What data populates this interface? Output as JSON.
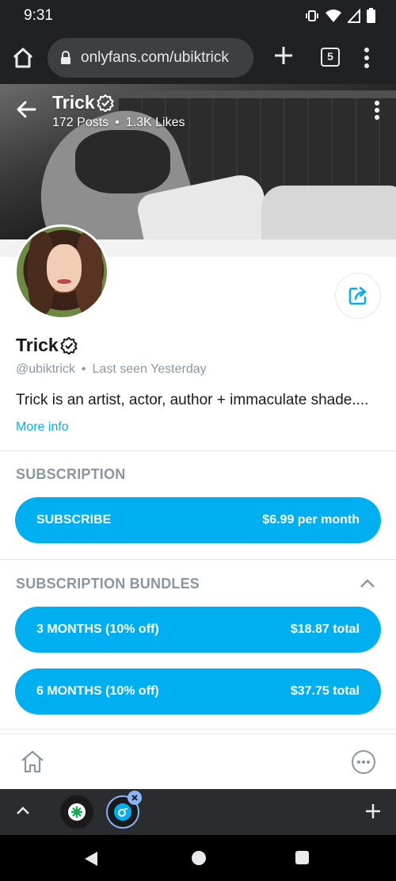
{
  "status_bar": {
    "time": "9:31"
  },
  "browser": {
    "url": "onlyfans.com/ubiktrick",
    "tab_count": "5"
  },
  "profile_header": {
    "name": "Trick",
    "posts": "172 Posts",
    "likes": "1.3K Likes",
    "separator": "•"
  },
  "profile": {
    "name": "Trick",
    "handle": "@ubiktrick",
    "last_seen": "Last seen Yesterday",
    "separator": "•",
    "bio": "Trick is an artist, actor, author + immaculate shade....",
    "more_info": "More info"
  },
  "subscription": {
    "title": "SUBSCRIPTION",
    "subscribe_label": "SUBSCRIBE",
    "price": "$6.99 per month"
  },
  "bundles": {
    "title": "SUBSCRIPTION BUNDLES",
    "items": [
      {
        "label": "3 MONTHS (10% off)",
        "price": "$18.87 total"
      },
      {
        "label": "6 MONTHS (10% off)",
        "price": "$37.75 total"
      }
    ]
  },
  "colors": {
    "accent": "#00aff0",
    "muted": "#8a96a3",
    "chrome_dark": "#202124"
  }
}
